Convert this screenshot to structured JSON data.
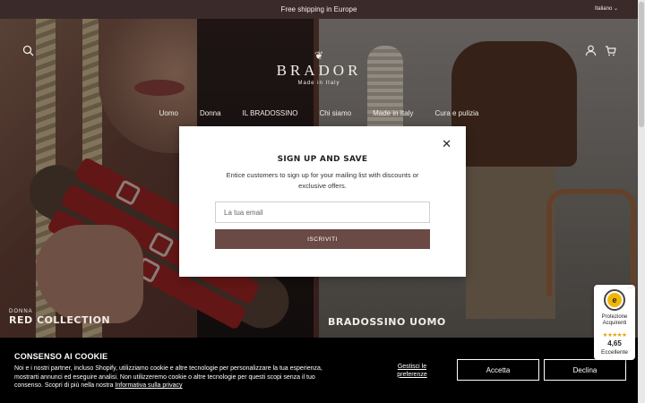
{
  "announcement": {
    "text": "Free shipping in Europe",
    "language": "Italiano"
  },
  "brand": {
    "name": "BRADOR",
    "tagline": "Made in Italy"
  },
  "header": {
    "icons": [
      "search-icon",
      "account-icon",
      "cart-icon"
    ]
  },
  "nav": {
    "items": [
      "Uomo",
      "Donna",
      "IL BRADOSSINO",
      "Chi siamo",
      "Made in Italy",
      "Cura e pulizia"
    ]
  },
  "collections": [
    {
      "small": "DONNA",
      "title": "RED COLLECTION"
    },
    {
      "small": "",
      "title": "BRADOSSINO UOMO"
    }
  ],
  "modal": {
    "title": "SIGN UP AND SAVE",
    "description": "Entice customers to sign up for your mailing list with discounts or exclusive offers.",
    "email_placeholder": "La tua email",
    "submit_label": "ISCRIVITI"
  },
  "cookie": {
    "title": "CONSENSO AI COOKIE",
    "text": "Noi e i nostri partner, incluso Shopify, utilizziamo cookie e altre tecnologie per personalizzare la tua esperienza, mostrarti annunci ed eseguire analisi. Non utilizzeremo cookie o altre tecnologie per questi scopi senza il tuo consenso. Scopri di più nella nostra",
    "policy_link": "Informativa sulla privacy",
    "preferences_label": "Gestisci le preferenze",
    "accept_label": "Accetta",
    "decline_label": "Declina"
  },
  "trust_badge": {
    "label": "Protezione Acquirenti",
    "seal_letter": "e",
    "stars": "★★★★★",
    "rating": 4.65,
    "rating_text": "4,65",
    "grade": "Eccellente"
  },
  "colors": {
    "accent": "#6b4a45",
    "announcement_bg": "#3b2a2a",
    "cookie_bg": "#000000"
  }
}
